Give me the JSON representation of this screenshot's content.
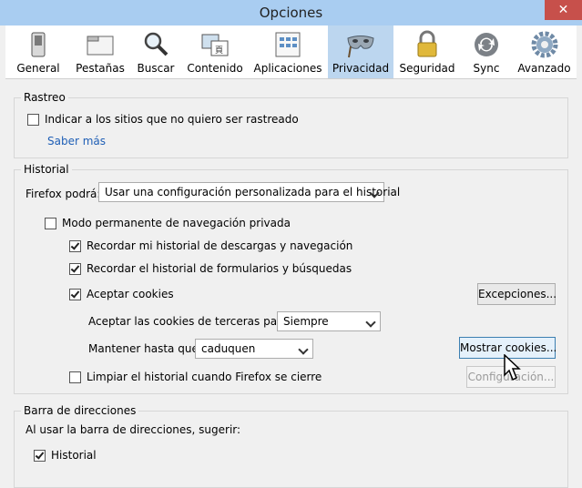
{
  "window": {
    "title": "Opciones",
    "close_glyph": "✕"
  },
  "toolbar": {
    "tabs": [
      {
        "label": "General",
        "icon": "switch-icon"
      },
      {
        "label": "Pestañas",
        "icon": "tabs-icon"
      },
      {
        "label": "Buscar",
        "icon": "magnifier-icon"
      },
      {
        "label": "Contenido",
        "icon": "content-icon"
      },
      {
        "label": "Aplicaciones",
        "icon": "applications-icon"
      },
      {
        "label": "Privacidad",
        "icon": "mask-icon",
        "selected": true
      },
      {
        "label": "Seguridad",
        "icon": "padlock-icon"
      },
      {
        "label": "Sync",
        "icon": "sync-icon"
      },
      {
        "label": "Avanzado",
        "icon": "gear-icon"
      }
    ]
  },
  "tracking": {
    "legend": "Rastreo",
    "checkbox_label": "Indicar a los sitios que no quiero ser rastreado",
    "checked": false,
    "learn_more": "Saber más"
  },
  "history": {
    "legend": "Historial",
    "firefox_label": "Firefox podrá:",
    "mode_select": "Usar una configuración personalizada para el historial",
    "private_mode_label": "Modo permanente de navegación privada",
    "private_mode_checked": false,
    "remember_downloads_label": "Recordar mi historial de descargas y navegación",
    "remember_downloads_checked": true,
    "remember_forms_label": "Recordar el historial de formularios y búsquedas",
    "remember_forms_checked": true,
    "accept_cookies_label": "Aceptar cookies",
    "accept_cookies_checked": true,
    "exceptions_button": "Excepciones...",
    "third_party_label": "Aceptar las cookies de terceras partes:",
    "third_party_select": "Siempre",
    "keep_until_label": "Mantener hasta que:",
    "keep_until_select": "caduquen",
    "show_cookies_button": "Mostrar cookies...",
    "clear_on_close_label": "Limpiar el historial cuando Firefox se cierre",
    "clear_on_close_checked": false,
    "settings_button": "Configuración..."
  },
  "location_bar": {
    "legend": "Barra de direcciones",
    "suggest_label": "Al usar la barra de direcciones, sugerir:",
    "history_label": "Historial",
    "history_checked": true
  },
  "colors": {
    "titlebar": "#a9cdf1",
    "selected_tab": "#bcd6ef",
    "link": "#1f5fb6",
    "close": "#c7504b"
  }
}
